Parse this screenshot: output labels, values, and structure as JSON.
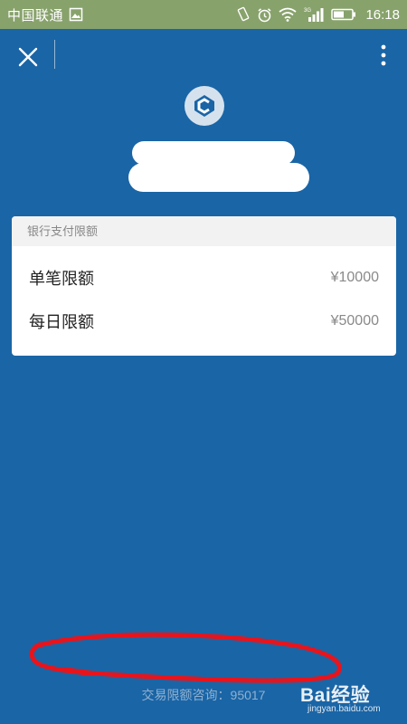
{
  "status_bar": {
    "carrier": "中国联通",
    "time": "16:18",
    "network": "3G",
    "icons": [
      "image-icon",
      "vibrate-icon",
      "alarm-icon",
      "wifi-icon",
      "signal-icon",
      "battery-icon"
    ]
  },
  "top_bar": {
    "close_icon": "close-icon",
    "more_icon": "more-vertical-icon"
  },
  "bank": {
    "logo_icon": "bank-logo-icon"
  },
  "limits_card": {
    "header": "银行支付限额",
    "rows": [
      {
        "label": "单笔限额",
        "value": "¥10000"
      },
      {
        "label": "每日限额",
        "value": "¥50000"
      }
    ]
  },
  "footer": {
    "consult": "交易限额咨询：95017"
  },
  "watermark": {
    "brand": "Bai经验",
    "domain": "jingyan.baidu.com"
  },
  "colors": {
    "background": "#1a65a6",
    "status_bar": "#88a26c",
    "annotation": "#e8141c"
  }
}
